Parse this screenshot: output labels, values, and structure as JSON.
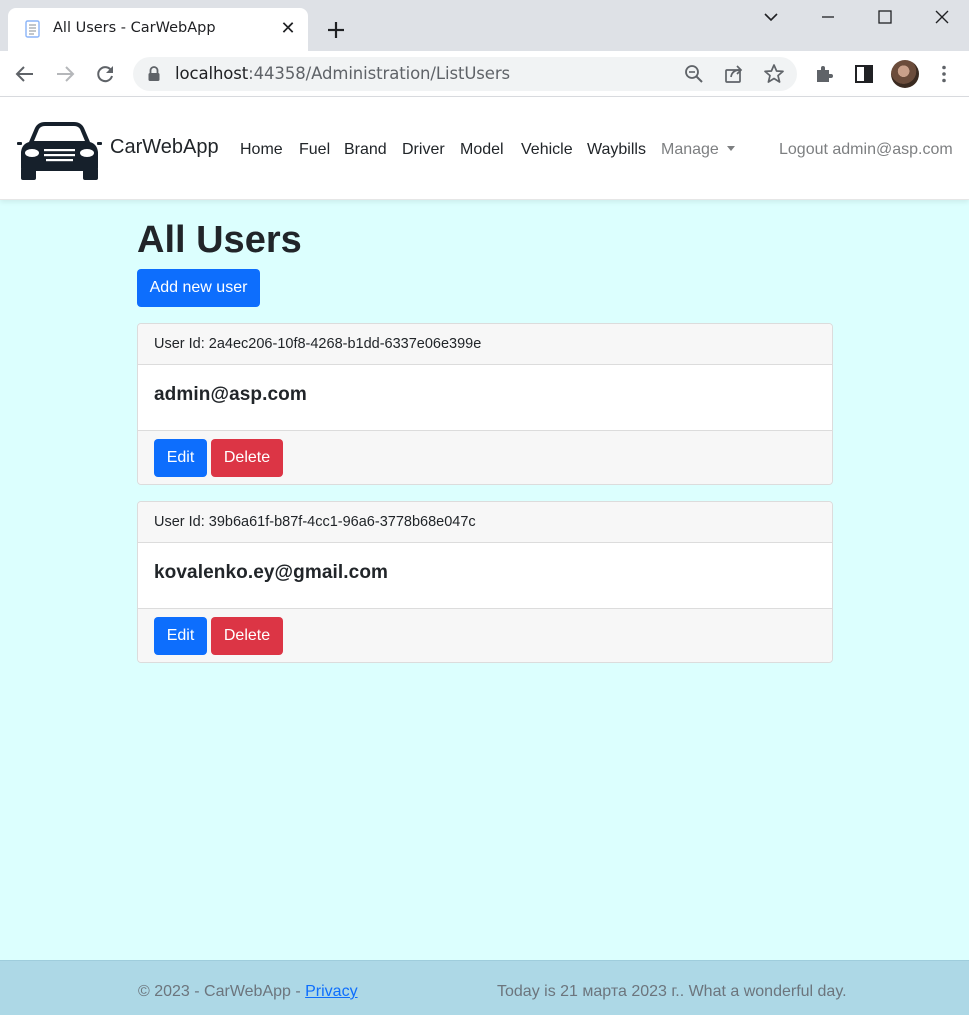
{
  "browser": {
    "tab_title": "All Users - CarWebApp",
    "url_host": "localhost",
    "url_rest": ":44358/Administration/ListUsers"
  },
  "navbar": {
    "brand": "CarWebApp",
    "items": [
      {
        "label": "Home"
      },
      {
        "label": "Fuel"
      },
      {
        "label": "Brand"
      },
      {
        "label": "Driver"
      },
      {
        "label": "Model"
      },
      {
        "label": "Vehicle"
      },
      {
        "label": "Waybills"
      }
    ],
    "manage_label": "Manage",
    "logout_label": "Logout admin@asp.com"
  },
  "main": {
    "title": "All Users",
    "add_button": "Add new user",
    "users": [
      {
        "id_label": "User Id: 2a4ec206-10f8-4268-b1dd-6337e06e399e",
        "email": "admin@asp.com",
        "edit_label": "Edit",
        "delete_label": "Delete"
      },
      {
        "id_label": "User Id: 39b6a61f-b87f-4cc1-96a6-3778b68e047c",
        "email": "kovalenko.ey@gmail.com",
        "edit_label": "Edit",
        "delete_label": "Delete"
      }
    ]
  },
  "footer": {
    "copyright": "© 2023 - CarWebApp - ",
    "privacy_link": "Privacy",
    "message": "Today is 21 марта 2023 г.. What a wonderful day."
  },
  "colors": {
    "page_bg": "#dcfffe",
    "primary": "#0d6efd",
    "danger": "#dc3545",
    "footer_bg": "#add8e6"
  }
}
